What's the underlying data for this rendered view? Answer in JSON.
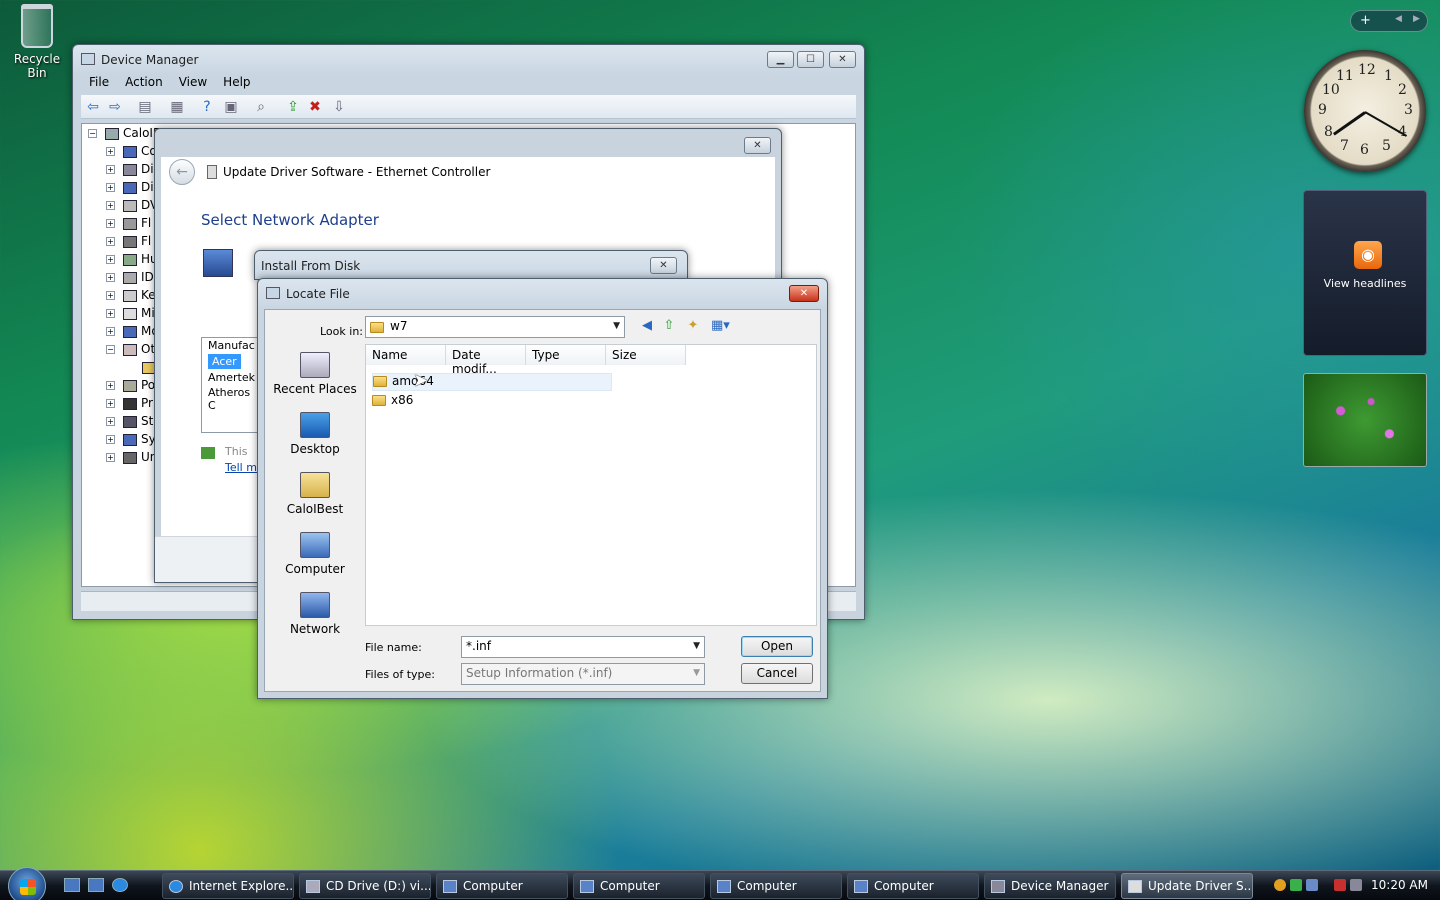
{
  "desktop": {
    "recycle_bin": "Recycle Bin"
  },
  "device_manager": {
    "title": "Device Manager",
    "menu": [
      "File",
      "Action",
      "View",
      "Help"
    ],
    "tree_root": "CaloIE",
    "tree_items": [
      "Co",
      "Di",
      "Di",
      "DV",
      "Fl",
      "Fl",
      "Hu",
      "ID",
      "Ke",
      "Mi",
      "Mo",
      "Ot",
      "",
      "Po",
      "Pr",
      "St",
      "Sy",
      "Un"
    ]
  },
  "update_driver": {
    "title": "Update Driver Software - Ethernet Controller",
    "heading": "Select Network Adapter",
    "manufacturer_header": "Manufac",
    "manufacturers": [
      "Acer",
      "Amertek",
      "Atheros C"
    ],
    "info_text": "This",
    "tell_link": "Tell m"
  },
  "install_from_disk": {
    "title": "Install From Disk"
  },
  "locate_file": {
    "title": "Locate File",
    "look_in_label": "Look in:",
    "look_in_value": "w7",
    "places": [
      "Recent Places",
      "Desktop",
      "CaloIBest",
      "Computer",
      "Network"
    ],
    "columns": [
      "Name",
      "Date modif...",
      "Type",
      "Size"
    ],
    "files": [
      "amd64",
      "x86"
    ],
    "file_name_label": "File name:",
    "file_name_value": "*.inf",
    "files_of_type_label": "Files of type:",
    "files_of_type_value": "Setup Information (*.inf)",
    "open_label": "Open",
    "cancel_label": "Cancel"
  },
  "gadgets": {
    "clock_numbers": [
      "12",
      "1",
      "2",
      "3",
      "4",
      "5",
      "6",
      "7",
      "8",
      "9",
      "10",
      "11"
    ],
    "feed_text": "View headlines"
  },
  "taskbar": {
    "buttons": [
      "Internet Explore...",
      "CD Drive (D:) vi...",
      "Computer",
      "Computer",
      "Computer",
      "Computer",
      "Device Manager",
      "Update Driver S..."
    ],
    "time": "10:20 AM"
  }
}
